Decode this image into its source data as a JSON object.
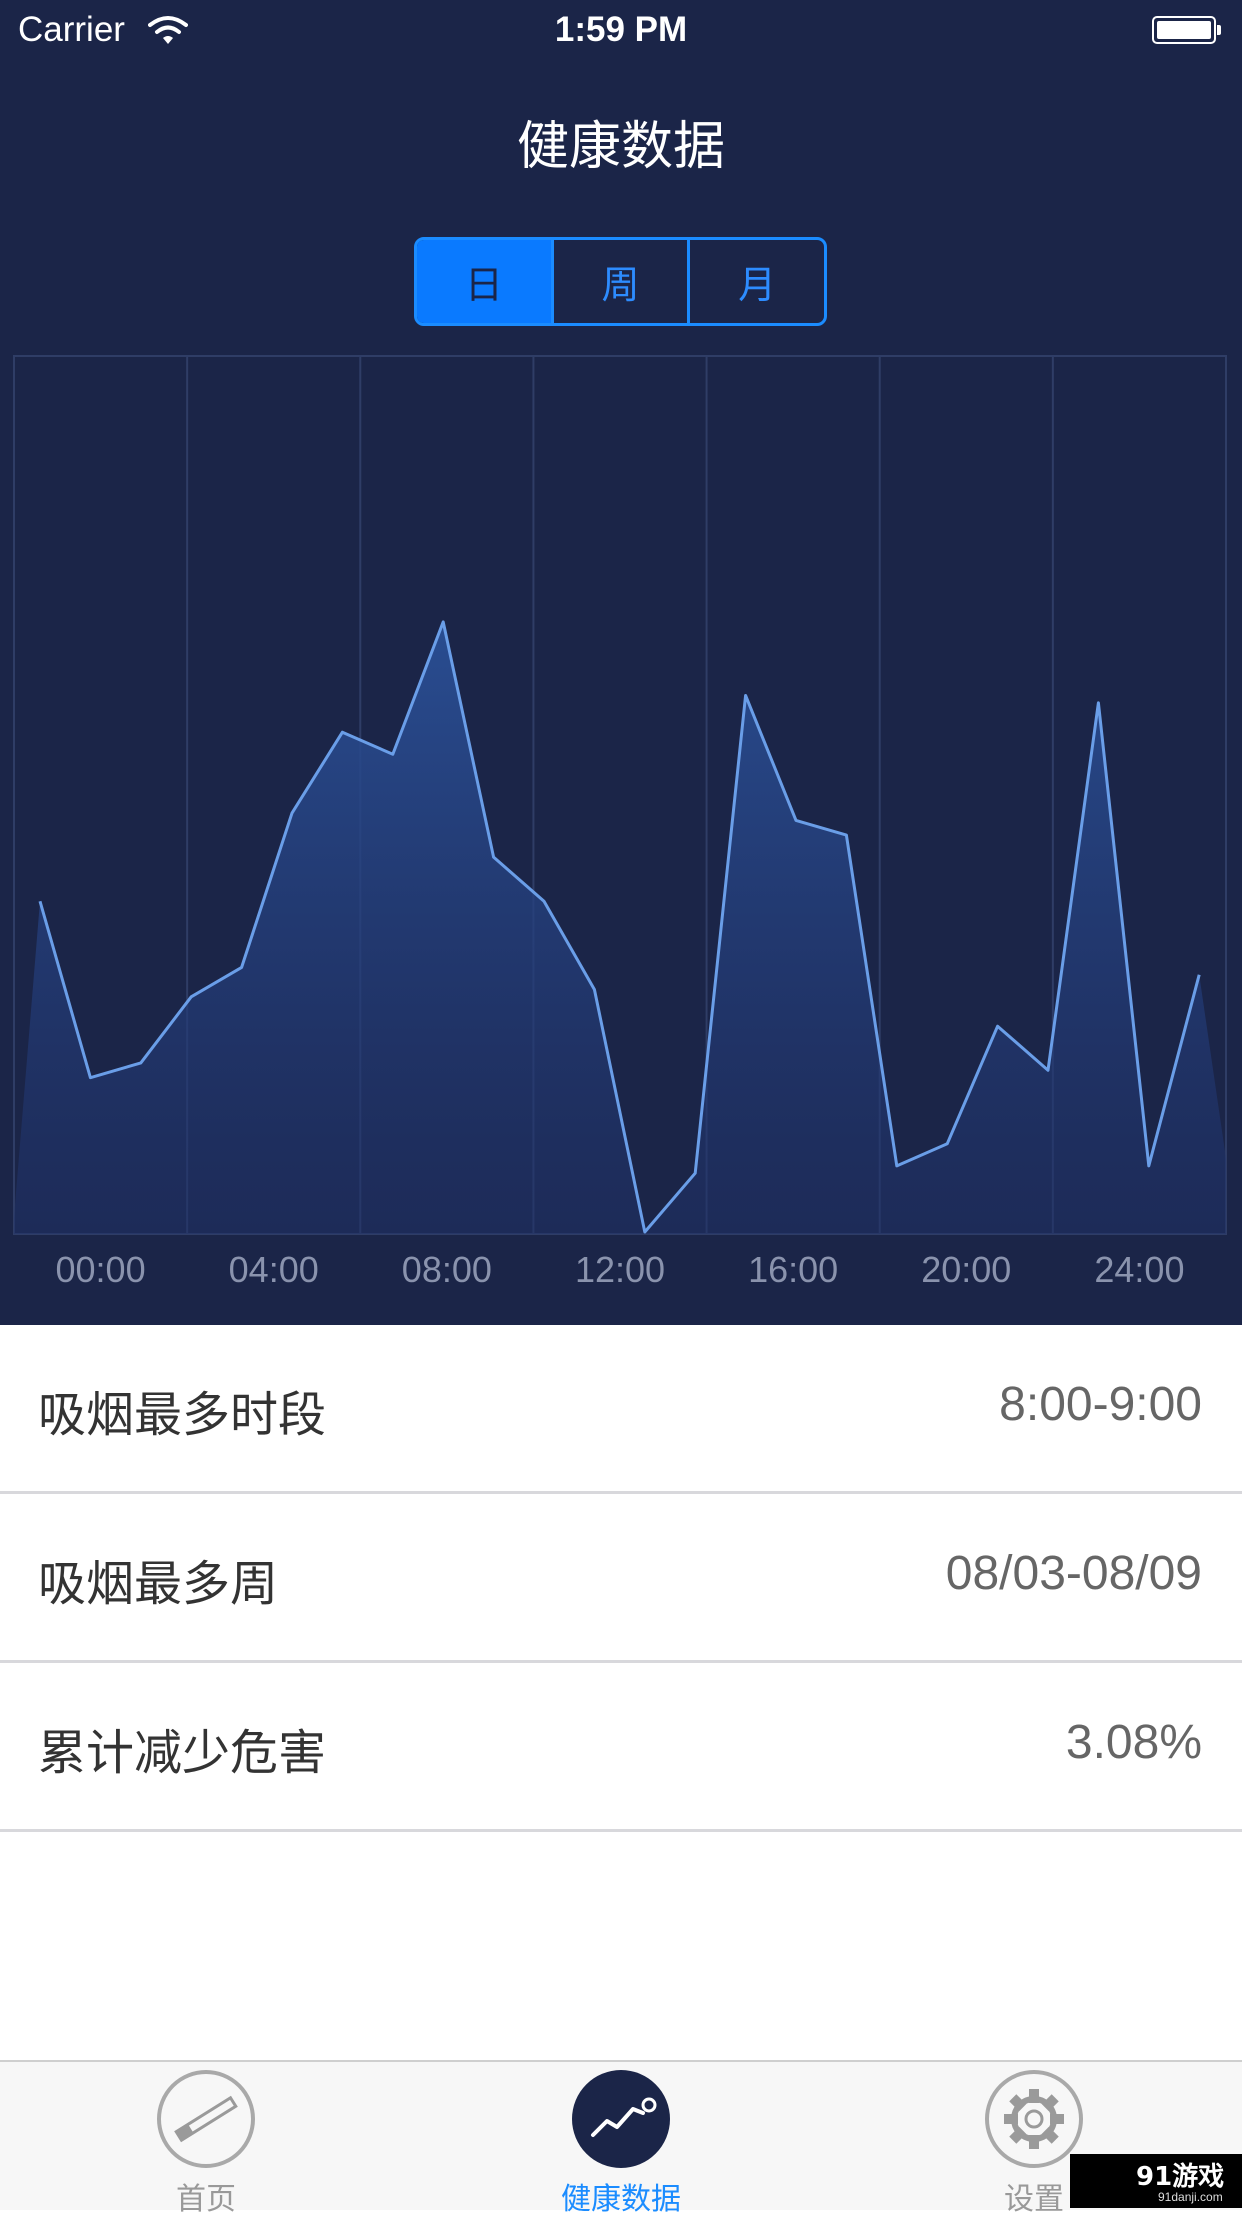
{
  "status_bar": {
    "carrier": "Carrier",
    "time": "1:59 PM"
  },
  "header": {
    "title": "健康数据"
  },
  "segments": [
    {
      "label": "日",
      "active": true
    },
    {
      "label": "周",
      "active": false
    },
    {
      "label": "月",
      "active": false
    }
  ],
  "chart_data": {
    "type": "area",
    "x_tick_labels": [
      "00:00",
      "04:00",
      "08:00",
      "12:00",
      "16:00",
      "20:00",
      "24:00"
    ],
    "y_range": [
      0,
      100
    ],
    "grid": true,
    "line_color": "#6a9ee8",
    "fill_color": "#2a4f95",
    "values": [
      2,
      45,
      21,
      23,
      32,
      36,
      57,
      68,
      65,
      83,
      51,
      45,
      33,
      0,
      8,
      73,
      56,
      54,
      9,
      12,
      28,
      22,
      72,
      9,
      35,
      10
    ]
  },
  "stats": [
    {
      "label": "吸烟最多时段",
      "value": "8:00-9:00"
    },
    {
      "label": "吸烟最多周",
      "value": "08/03-08/09"
    },
    {
      "label": "累计减少危害",
      "value": "3.08%"
    }
  ],
  "tabbar": {
    "items": [
      {
        "label": "首页",
        "icon": "cigarette-icon",
        "active": false
      },
      {
        "label": "健康数据",
        "icon": "chart-trend-icon",
        "active": true
      },
      {
        "label": "设置",
        "icon": "gear-icon",
        "active": false
      }
    ]
  },
  "watermark": {
    "text": "91游戏",
    "sub": "91danji.com"
  },
  "colors": {
    "header_bg": "#1b2548",
    "accent": "#1b8cff"
  }
}
